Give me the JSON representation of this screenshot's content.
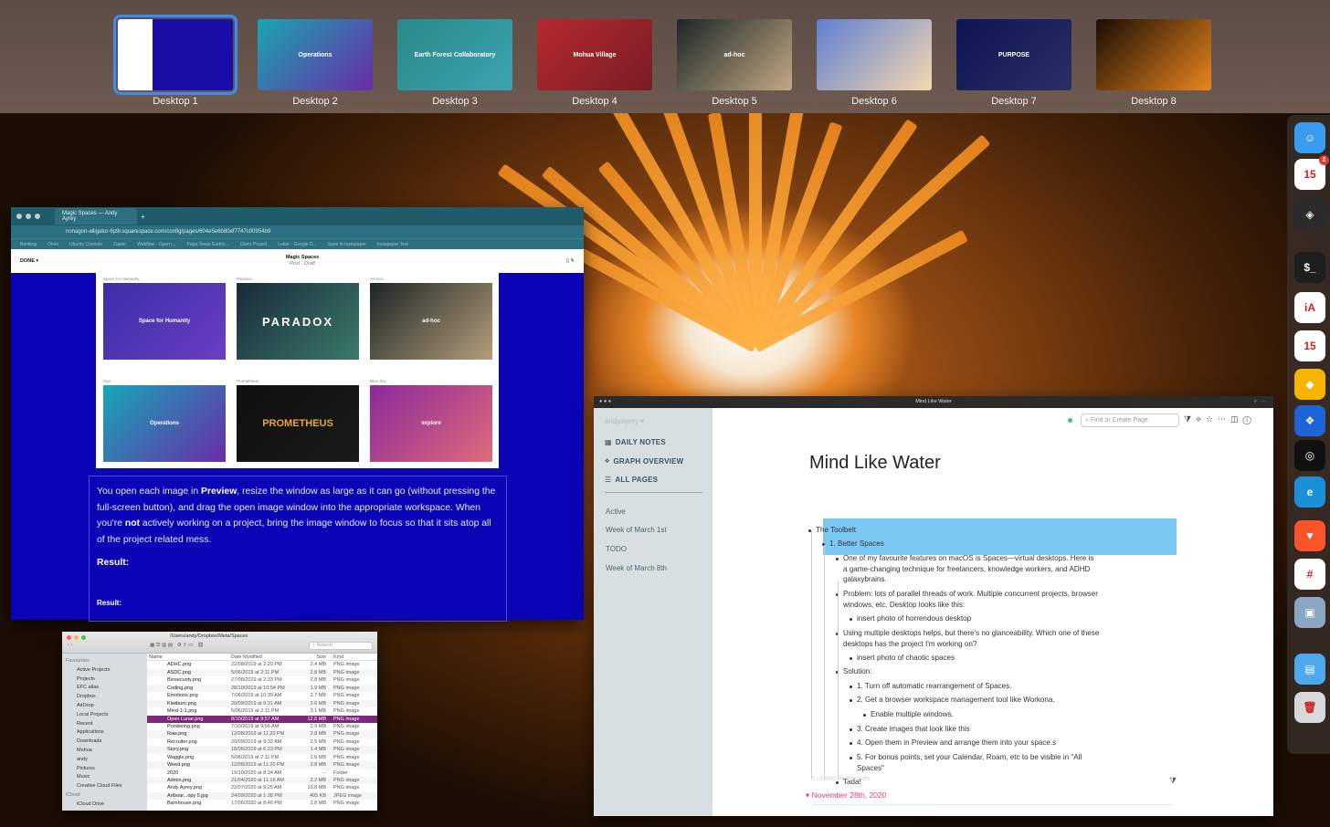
{
  "spaces": {
    "desktops": [
      {
        "label": "Desktop 1",
        "caption": "",
        "colors": [
          "#fff",
          "#1b0ea8"
        ]
      },
      {
        "label": "Desktop 2",
        "caption": "Operations",
        "colors": [
          "#1aa6b0",
          "#6a2ca8"
        ]
      },
      {
        "label": "Desktop 3",
        "caption": "Earth Forest Collaboratory",
        "colors": [
          "#2a8a8a",
          "#3ca3b1"
        ]
      },
      {
        "label": "Desktop 4",
        "caption": "Mohua Village",
        "colors": [
          "#b52a2f",
          "#7a1c25"
        ]
      },
      {
        "label": "Desktop 5",
        "caption": "ad-hoc",
        "colors": [
          "#1c2626",
          "#c2a983"
        ]
      },
      {
        "label": "Desktop 6",
        "caption": "",
        "colors": [
          "#5e7ed1",
          "#f5d8b0"
        ]
      },
      {
        "label": "Desktop 7",
        "caption": "PURPOSE",
        "colors": [
          "#0d1452",
          "#2a2f66"
        ]
      },
      {
        "label": "Desktop 8",
        "caption": "",
        "colors": [
          "#1a0c04",
          "#e9861d"
        ]
      }
    ]
  },
  "dock": {
    "items": [
      {
        "name": "finder",
        "glyph": "☺",
        "color": "#3a9cf0"
      },
      {
        "name": "calendar",
        "glyph": "15",
        "color": "#ffffff",
        "badge": "2"
      },
      {
        "name": "layers",
        "glyph": "◈",
        "color": "#2b2b2b"
      },
      {
        "name": "terminal",
        "glyph": "$_",
        "color": "#1e1e1e"
      },
      {
        "name": "ia-writer",
        "glyph": "iA",
        "color": "#ffffff"
      },
      {
        "name": "fantastical",
        "glyph": "15",
        "color": "#ffffff"
      },
      {
        "name": "sketch",
        "glyph": "◆",
        "color": "#f7b500"
      },
      {
        "name": "dropbox",
        "glyph": "❖",
        "color": "#1e64d6"
      },
      {
        "name": "circle-app",
        "glyph": "◎",
        "color": "#111111"
      },
      {
        "name": "edge",
        "glyph": "e",
        "color": "#1b8fd8"
      },
      {
        "name": "brave",
        "glyph": "▼",
        "color": "#fb542b"
      },
      {
        "name": "slack",
        "glyph": "#",
        "color": "#ffffff"
      },
      {
        "name": "preview",
        "glyph": "▣",
        "color": "#8aa6c0"
      },
      {
        "name": "downloads",
        "glyph": "▤",
        "color": "#4ea8ec"
      },
      {
        "name": "trash",
        "glyph": "🗑",
        "color": "#d9d9d9"
      }
    ]
  },
  "browser": {
    "tab": "Magic Spaces — Andy Ayrey",
    "url": "nonagon-alligator-6p9l.squarespace.com/config/pages/604e5e6b80ef7747c00954b9",
    "bookmarks": [
      "Banking",
      "Ohvo",
      "Ubuntu Console",
      "Zapier",
      "Webflow - Open i...",
      "Papa Texas Earthc...",
      "Client Project",
      "Letter - Google D...",
      "Save to Instapaper",
      "Instapaper Text"
    ],
    "done": "DONE",
    "page_title": "Magic Spaces",
    "page_status": "Post · Draft",
    "gallery": [
      {
        "caption": "Space for Humanity",
        "label": "Space for Humanity",
        "c1": "#3b2ea8",
        "c2": "#6a3fc2"
      },
      {
        "caption": "Paradox",
        "label": "PARADOX",
        "c1": "#1a2a3a",
        "c2": "#3a7a6a"
      },
      {
        "caption": "Ad-Hoc",
        "label": "ad-hoc",
        "c1": "#1c2626",
        "c2": "#b49d7a"
      },
      {
        "caption": "Ops",
        "label": "Operations",
        "c1": "#17a8b8",
        "c2": "#6a2ca8"
      },
      {
        "caption": "Prometheus",
        "label": "PROMETHEUS",
        "c1": "#0f0f0f",
        "c2": "#1a1a1a"
      },
      {
        "caption": "Blue Sky",
        "label": "explore",
        "c1": "#8a2a9c",
        "c2": "#e06a7a"
      }
    ],
    "body_parts": [
      "You open each image in ",
      "Preview",
      ", resize the window as large as it can go (without pressing the full-screen button), and drag the open image window into the appropriate workspace. When you're ",
      "not",
      " actively working on a project, bring the image window to focus so that it sits atop all of the project related mess."
    ],
    "result1": "Result:",
    "result2": "Result:"
  },
  "finder": {
    "path": "/Users/andy/Dropbox/Meta/Spaces",
    "search": "Search",
    "headers": [
      "Name",
      "Date Modified",
      "Size",
      "Kind"
    ],
    "sidebar": [
      {
        "label": "Favourites",
        "h": true
      },
      {
        "label": "Active Projects"
      },
      {
        "label": "Projects"
      },
      {
        "label": "EFC atlas"
      },
      {
        "label": "Dropbox"
      },
      {
        "label": "AirDrop"
      },
      {
        "label": "Local Projects"
      },
      {
        "label": "Recent"
      },
      {
        "label": "Applications"
      },
      {
        "label": "Downloads"
      },
      {
        "label": "Mohua"
      },
      {
        "label": "andy"
      },
      {
        "label": "Pictures"
      },
      {
        "label": "Music"
      },
      {
        "label": "Creative Cloud Files"
      },
      {
        "label": "iCloud",
        "h": true
      },
      {
        "label": "iCloud Drive"
      }
    ],
    "rows": [
      [
        "ADHC.png",
        "22/08/2019 at 2:20 PM",
        "2.4 MB",
        "PNG image"
      ],
      [
        "ASDC.png",
        "5/06/2019 at 2:11 PM",
        "2.8 MB",
        "PNG image"
      ],
      [
        "Biosecurity.png",
        "27/08/2019 at 2:33 PM",
        "2.8 MB",
        "PNG image"
      ],
      [
        "Coding.png",
        "28/10/2019 at 10:54 PM",
        "1.9 MB",
        "PNG image"
      ],
      [
        "Emotions.png",
        "7/06/2019 at 10:39 AM",
        "2.7 MB",
        "PNG image"
      ],
      [
        "Kiwiburn.png",
        "20/09/2019 at 9:31 AM",
        "2.6 MB",
        "PNG image"
      ],
      [
        "Mind-1-1.png",
        "5/06/2019 at 2:11 PM",
        "3.1 MB",
        "PNG image"
      ],
      [
        "Open Lunar.png",
        "8/10/2019 at 9:57 AM",
        "12.8 MB",
        "PNG image"
      ],
      [
        "Pondering.png",
        "7/10/2019 at 9:56 AM",
        "2.9 MB",
        "PNG image"
      ],
      [
        "Raw.png",
        "12/08/2019 at 11:20 PM",
        "2.8 MB",
        "PNG image"
      ],
      [
        "Recruiter.png",
        "20/09/2019 at 9:32 AM",
        "2.5 MB",
        "PNG image"
      ],
      [
        "Story.png",
        "18/06/2019 at 6:23 PM",
        "1.4 MB",
        "PNG image"
      ],
      [
        "Waggle.png",
        "5/06/2019 at 2:11 PM",
        "2.6 MB",
        "PNG image"
      ],
      [
        "Weed.png",
        "12/08/2019 at 11:20 PM",
        "2.8 MB",
        "PNG image"
      ],
      [
        "2020",
        "19/10/2020 at 8:34 AM",
        "--",
        "Folder"
      ],
      [
        "Admin.png",
        "21/04/2020 at 11:16 AM",
        "2.2 MB",
        "PNG image"
      ],
      [
        "Andy Ayrey.png",
        "22/07/2020 at 9:25 AM",
        "10.8 MB",
        "PNG image"
      ],
      [
        "Artboar...opy 5.jpg",
        "24/09/2020 at 1:38 PM",
        "405 KB",
        "JPEG image"
      ],
      [
        "Barnhouse.png",
        "17/06/2020 at 8:46 PM",
        "2.8 MB",
        "PNG image"
      ]
    ],
    "selected_row": 7
  },
  "roam": {
    "window_title": "Mind Like Water",
    "graph_name": "andyayrey",
    "nav": [
      "DAILY NOTES",
      "GRAPH OVERVIEW",
      "ALL PAGES"
    ],
    "shortcuts": [
      "Active",
      "Week of March 1st",
      "TODO",
      "Week of March 8th"
    ],
    "search_placeholder": "Find or Create Page",
    "page_title": "Mind Like Water",
    "blocks": [
      "The Toolbelt",
      "1. Better Spaces",
      "One of my favourite features on macOS is Spaces—virtual desktops. Here is a game-changing technique for freelancers, knowledge workers, and ADHD galaxybrains.",
      "Problem: lots of parallel threads of work. Multiple concurrent projects, browser windows, etc. Desktop looks like this:",
      "insert photo of horrendous desktop",
      "Using multiple desktops helps, but there's no glanceability. Which one of these desktops has the project I'm working on?",
      "insert photo of chaotic spaces",
      "Solution:",
      "1. Turn off automatic rearrangement of Spaces.",
      "2. Get a browser workspace management tool like Workona.",
      "Enable multiple windows.",
      "3. Create images that look like this",
      "4. Open them in Preview and arrange them into your space.s",
      "5. For bonus points, set your Calendar, Roam, etc to be visible in \"All Spaces\"",
      "Tada!"
    ],
    "linked_refs": "5 Linked References",
    "ref_date": "November 28th, 2020"
  }
}
